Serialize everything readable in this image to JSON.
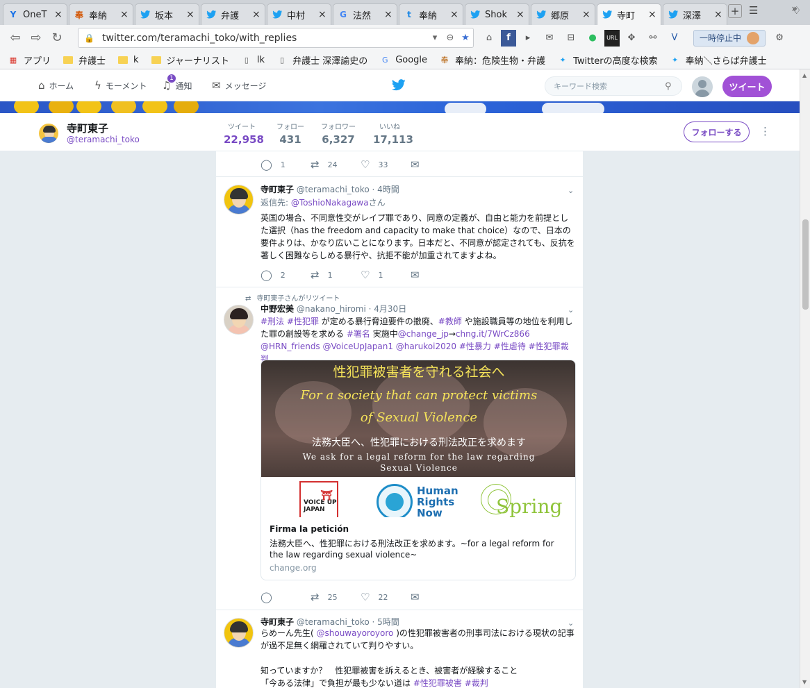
{
  "browser": {
    "tabs": [
      {
        "label": "OneT",
        "icon": "Y",
        "icon_color": "#1a73e8",
        "active": false
      },
      {
        "label": "奉納",
        "icon": "奉",
        "icon_color": "#d35400",
        "active": false
      },
      {
        "label": "坂本",
        "icon": "twitter",
        "icon_color": "#1da1f2",
        "active": false
      },
      {
        "label": "弁護",
        "icon": "twitter",
        "icon_color": "#1da1f2",
        "active": false
      },
      {
        "label": "中村",
        "icon": "twitter",
        "icon_color": "#1da1f2",
        "active": false
      },
      {
        "label": "法然",
        "icon": "G",
        "icon_color": "#4285f4",
        "active": false
      },
      {
        "label": "奉納",
        "icon": "t",
        "icon_color": "#1e88e5",
        "active": false
      },
      {
        "label": "Shok",
        "icon": "twitter",
        "icon_color": "#1da1f2",
        "active": false
      },
      {
        "label": "郷原",
        "icon": "twitter",
        "icon_color": "#1da1f2",
        "active": false
      },
      {
        "label": "寺町",
        "icon": "twitter",
        "icon_color": "#1da1f2",
        "active": true
      },
      {
        "label": "深澤",
        "icon": "twitter",
        "icon_color": "#1da1f2",
        "active": false
      }
    ],
    "url": "twitter.com/teramachi_toko/with_replies",
    "pause_label": "一時停止中",
    "bookmarks": [
      {
        "label": "アプリ",
        "kind": "apps"
      },
      {
        "label": "弁護士",
        "kind": "folder"
      },
      {
        "label": "k",
        "kind": "folder"
      },
      {
        "label": "ジャーナリスト",
        "kind": "folder"
      },
      {
        "label": "lk",
        "kind": "page"
      },
      {
        "label": "弁護士 深澤諭史の",
        "kind": "page"
      },
      {
        "label": "Google",
        "kind": "google"
      },
      {
        "label": "奉納：危険生物・弁護",
        "kind": "hounou"
      },
      {
        "label": "Twitterの高度な検索",
        "kind": "twitter"
      },
      {
        "label": "奉納＼さらば弁護士",
        "kind": "twitter"
      }
    ]
  },
  "twitter_nav": {
    "home": "ホーム",
    "moments": "モーメント",
    "notifications": "通知",
    "notifications_badge": "1",
    "messages": "メッセージ",
    "search_placeholder": "キーワード検索",
    "tweet_button": "ツイート"
  },
  "profile": {
    "name": "寺町東子",
    "handle": "@teramachi_toko",
    "stats": [
      {
        "label": "ツイート",
        "value": "22,958",
        "active": true
      },
      {
        "label": "フォロー",
        "value": "431",
        "active": false
      },
      {
        "label": "フォロワー",
        "value": "6,327",
        "active": false
      },
      {
        "label": "いいね",
        "value": "17,113",
        "active": false
      }
    ],
    "follow_button": "フォローする"
  },
  "tweets": {
    "t0": {
      "reply": "1",
      "retweet": "24",
      "like": "33"
    },
    "t1": {
      "name": "寺町東子",
      "handle": "@teramachi_toko",
      "time": "· 4時間",
      "reply_prefix": "返信先:",
      "reply_to": "@ToshioNakagawa",
      "reply_suffix": "さん",
      "body": "英国の場合、不同意性交がレイプ罪であり、同意の定義が、自由と能力を前提とした選択（has the freedom and capacity to make that choice）なので、日本の要件よりは、かなり広いことになります。日本だと、不同意が認定されても、反抗を著しく困難ならしめる暴行や、抗拒不能が加重されてますよね。",
      "reply": "2",
      "retweet": "1",
      "like": "1"
    },
    "t2": {
      "retweeted_by": "寺町東子さんがリツイート",
      "name": "中野宏美",
      "handle": "@nakano_hiromi",
      "time": "· 4月30日",
      "body_parts": [
        {
          "text": "#刑法",
          "link": true
        },
        {
          "text": " ",
          "link": false
        },
        {
          "text": "#性犯罪",
          "link": true
        },
        {
          "text": " が定める暴行脅迫要件の撤廃、",
          "link": false
        },
        {
          "text": "#教師",
          "link": true
        },
        {
          "text": " や施設職員等の地位を利用した罪の創設等を求める ",
          "link": false
        },
        {
          "text": "#署名",
          "link": true
        },
        {
          "text": " 実施中",
          "link": false
        },
        {
          "text": "@change_jp",
          "link": true
        },
        {
          "text": "→",
          "link": false
        },
        {
          "text": "chng.it/7WrCz866",
          "link": true
        },
        {
          "text": " ",
          "link": false
        },
        {
          "text": "@HRN_friends",
          "link": true
        },
        {
          "text": " ",
          "link": false
        },
        {
          "text": "@VoiceUpJapan1",
          "link": true
        },
        {
          "text": " ",
          "link": false
        },
        {
          "text": "@harukoi2020",
          "link": true
        },
        {
          "text": " ",
          "link": false
        },
        {
          "text": "#性暴力",
          "link": true
        },
        {
          "text": " ",
          "link": false
        },
        {
          "text": "#性虐待",
          "link": true
        },
        {
          "text": " ",
          "link": false
        },
        {
          "text": "#性犯罪裁判",
          "link": true
        }
      ],
      "card": {
        "line1": "性犯罪被害者を守れる社会へ",
        "line2": "For a society that can protect victims",
        "line3": "of Sexual Violence",
        "line4": "法務大臣へ、性犯罪における刑法改正を求めます",
        "line5": "We ask for a legal reform for the law regarding",
        "line6": "Sexual Violence",
        "logo1": "VOICE UP JAPAN",
        "logo2_line1": "Human",
        "logo2_line2": "Rights",
        "logo2_line3": "Now",
        "logo3": "Spring",
        "title": "Firma la petición",
        "desc": "法務大臣へ、性犯罪における刑法改正を求めます。~for a legal reform for the law regarding sexual violence~",
        "domain": "change.org"
      },
      "reply": "",
      "retweet": "25",
      "like": "22"
    },
    "t3": {
      "name": "寺町東子",
      "handle": "@teramachi_toko",
      "time": "· 5時間",
      "line1_a": "らめーん先生( ",
      "line1_link": "@shouwayoroyoro",
      "line1_b": " )の性犯罪被害者の刑事司法における現状の記事",
      "line2": "が過不足無く網羅されていて判りやすい。",
      "line3": "知っていますか？　性犯罪被害を訴えるとき、被害者が経験すること",
      "line4_a": "「今ある法律」で負担が最も少ない道は ",
      "line4_link1": "#性犯罪被害",
      "line4_link2": "#裁判"
    }
  }
}
